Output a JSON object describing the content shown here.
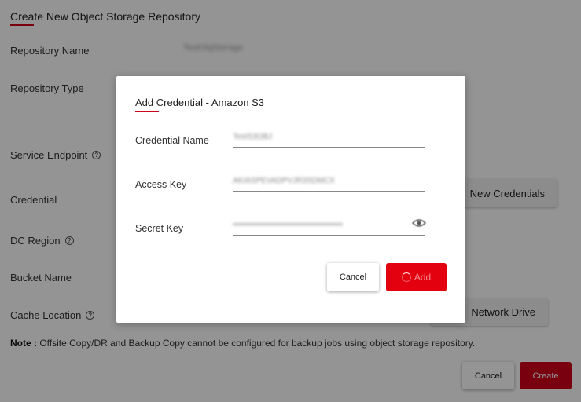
{
  "background": {
    "title": "Create New Object Storage Repository",
    "fields": {
      "repository_name": "Repository Name",
      "repository_type": "Repository Type",
      "service_endpoint": "Service Endpoint",
      "credential": "Credential",
      "dc_region": "DC Region",
      "bucket_name": "Bucket Name",
      "cache_location": "Cache Location"
    },
    "repository_name_value": "TestObjStorage",
    "new_credentials_button": "New Credentials",
    "network_drive_button": "Network Drive",
    "note_prefix": "Note :",
    "note_text": " Offsite Copy/DR and Backup Copy cannot be configured for backup jobs using object storage repository.",
    "cancel_button": "Cancel",
    "create_button": "Create"
  },
  "modal": {
    "title": "Add Credential - Amazon S3",
    "credential_name_label": "Credential Name",
    "credential_name_value": "TestS3OBJ",
    "access_key_label": "Access Key",
    "access_key_value": "AKIASPEVADPVJR3SDMCX",
    "secret_key_label": "Secret Key",
    "secret_key_value": "••••••••••••••••••••••••••••••••••••••••",
    "cancel_button": "Cancel",
    "add_button": "Add"
  },
  "colors": {
    "accent": "#d0021b",
    "add_button": "#e3000f",
    "overlay": "rgba(0,0,0,0.42)"
  },
  "icons": {
    "help": "help-circle-icon",
    "password_toggle": "eye-icon",
    "loading": "spinner-icon"
  }
}
